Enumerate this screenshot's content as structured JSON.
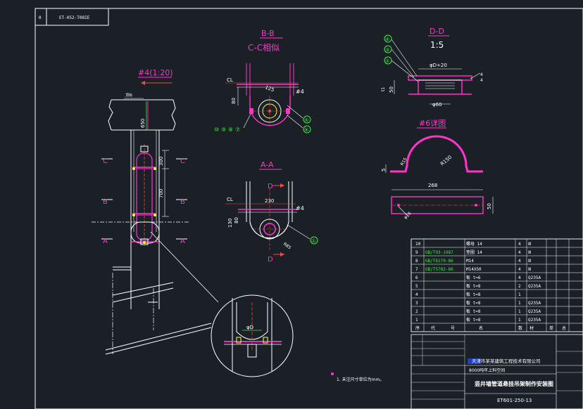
{
  "drawing": {
    "frame_stamp_index": "0",
    "frame_stamp_code": "ET-052-T08IE",
    "views": {
      "bb_title": "B-B",
      "cc_subtitle": "C-C相似",
      "dd_title": "D-D",
      "dd_scale": "1:5",
      "aa_title": "A-A",
      "part4_title": "#4(1:20)",
      "part6_title": "#6详图"
    },
    "labels": {
      "cl1": "CL",
      "cl2": "CL",
      "p4a": "#4",
      "p4b": "#4",
      "dim_125": "125",
      "dim_80": "80",
      "dim_230": "230",
      "dim_130": "130",
      "dim_80b": "80",
      "dim_650": "650",
      "dim_300": "300",
      "dim_700": "700",
      "phi_d20": "φD+20",
      "phi_d": "φD",
      "phi_60": "φ60",
      "dim_50": "50",
      "dim_t": "t1",
      "dim_5": "5",
      "dim_268": "268",
      "dim_50b": "50",
      "r150": "R150",
      "r15": "R15",
      "r85": "R85",
      "phi16": "φ16",
      "small_4": "4",
      "small_4b": "4",
      "top_mark": "顶标",
      "section_letters": [
        "C",
        "C",
        "B",
        "B",
        "A",
        "A"
      ],
      "d_letter1": "D",
      "d_letter2": "D",
      "balloons_bb": [
        "⑩",
        "⑨",
        "⑧",
        "⑦"
      ],
      "balloon_5": "⑤",
      "balloon_6": "⑥",
      "balloon_1": "①",
      "balloons_dd": [
        "④",
        "③",
        "②"
      ],
      "note": "1. 未注尺寸单位为mm。"
    },
    "parts_table": {
      "rows": [
        {
          "no": "10",
          "std": "",
          "name": "螺母 14",
          "qty": "4",
          "mat": "Ⅲ"
        },
        {
          "no": "9",
          "std": "GB/T93-1987",
          "name": "垫圈 14",
          "qty": "4",
          "mat": "Ⅲ"
        },
        {
          "no": "8",
          "std": "GB/T6170-86",
          "name": "M14",
          "qty": "4",
          "mat": "Ⅲ"
        },
        {
          "no": "7",
          "std": "GB/T5782-86",
          "name": "M14X50",
          "qty": "4",
          "mat": "Ⅲ"
        },
        {
          "no": "6",
          "std": "",
          "name": "板 t=6",
          "qty": "4",
          "mat": "Q235A"
        },
        {
          "no": "5",
          "std": "",
          "name": "板 t=8",
          "qty": "2",
          "mat": "Q235A"
        },
        {
          "no": "4",
          "std": "",
          "name": "板 t=8",
          "qty": "1",
          "mat": ""
        },
        {
          "no": "3",
          "std": "",
          "name": "板 t=8",
          "qty": "1",
          "mat": "Q235A"
        },
        {
          "no": "2",
          "std": "",
          "name": "板 t=8",
          "qty": "1",
          "mat": "Q235A"
        },
        {
          "no": "1",
          "std": "",
          "name": "板 t=8",
          "qty": "1",
          "mat": "Q235A"
        }
      ],
      "header": [
        "序",
        "代",
        "号",
        "名",
        "数",
        "材",
        "单",
        "总"
      ]
    },
    "title_block": {
      "company": "天津市某某建筑工程技术有限公司",
      "project": "8000吨年上料空间",
      "drawing_name": "竖井墙管道悬挂吊架制作安装图",
      "drawing_no": "ET601-250-13"
    },
    "colors": {
      "background": "#1b2027",
      "magenta": "#ff33cc",
      "green": "#3ee84a",
      "yellow": "#ffff33",
      "cyan": "#33e8ff",
      "white": "#ffffff",
      "red": "#ff4444"
    }
  }
}
